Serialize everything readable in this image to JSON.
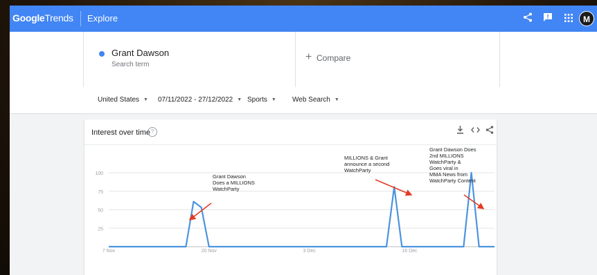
{
  "topbar": {
    "logo_google": "Google",
    "logo_trends": "Trends",
    "section": "Explore",
    "avatar_initial": "M"
  },
  "search": {
    "term": "Grant Dawson",
    "term_type": "Search term",
    "compare_label": "Compare",
    "dot_color": "#4285f4"
  },
  "filters": {
    "region": "United States",
    "date_range": "07/11/2022 - 27/12/2022",
    "category": "Sports",
    "search_type": "Web Search"
  },
  "card": {
    "title": "Interest over time"
  },
  "chart_data": {
    "type": "line",
    "x": [
      "7 Nov",
      "8 Nov",
      "9 Nov",
      "10 Nov",
      "11 Nov",
      "12 Nov",
      "13 Nov",
      "14 Nov",
      "15 Nov",
      "16 Nov",
      "17 Nov",
      "18 Nov",
      "19 Nov",
      "20 Nov",
      "21 Nov",
      "22 Nov",
      "23 Nov",
      "24 Nov",
      "25 Nov",
      "26 Nov",
      "27 Nov",
      "28 Nov",
      "29 Nov",
      "30 Nov",
      "1 Dec",
      "2 Dec",
      "3 Dec",
      "4 Dec",
      "5 Dec",
      "6 Dec",
      "7 Dec",
      "8 Dec",
      "9 Dec",
      "10 Dec",
      "11 Dec",
      "12 Dec",
      "13 Dec",
      "14 Dec",
      "15 Dec",
      "16 Dec",
      "17 Dec",
      "18 Dec",
      "19 Dec",
      "20 Dec",
      "21 Dec",
      "22 Dec",
      "23 Dec",
      "24 Dec",
      "25 Dec",
      "26 Dec",
      "27 Dec"
    ],
    "series": [
      {
        "values": [
          0,
          0,
          0,
          0,
          0,
          0,
          0,
          0,
          0,
          0,
          0,
          61,
          53,
          0,
          0,
          0,
          0,
          0,
          0,
          0,
          0,
          0,
          0,
          0,
          0,
          0,
          0,
          0,
          0,
          0,
          0,
          0,
          0,
          0,
          0,
          0,
          0,
          0,
          0,
          0,
          0,
          0,
          0,
          0,
          0,
          0,
          0,
          0,
          0,
          0,
          0
        ]
      }
    ],
    "spike_dec": {
      "date_a": "14 Dec",
      "value_a": 81,
      "date_b": "24 Dec",
      "value_b": 100
    },
    "ylim": [
      0,
      100
    ],
    "yticks": [
      25,
      50,
      75,
      100
    ],
    "xticks": [
      "7 Nov",
      "20 Nov",
      "3 Dec",
      "16 Dec"
    ],
    "grid": true,
    "line_color": "#4a94e0",
    "annotations": [
      {
        "text": "Grant Dawson\nDoes a MILLIONS\nWatchParty",
        "target": "12 Nov"
      },
      {
        "text": "MILLIONS & Grant\nannounce a second\nWatchParty",
        "target": "14 Dec"
      },
      {
        "text": "Grant Dawson Does\n2nd MILLIONS\nWatchParty &\nGoes viral in\nMMA News from\nWatchParty Content",
        "target": "24 Dec"
      }
    ],
    "arrow_color": "#e53a25"
  }
}
